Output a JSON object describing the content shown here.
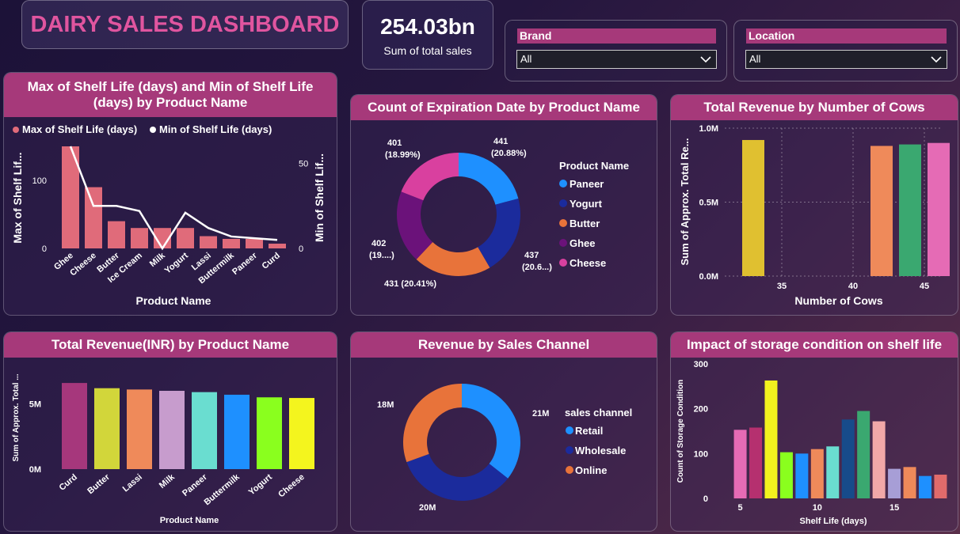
{
  "header": {
    "title": "DAIRY SALES DASHBOARD",
    "kpi_value": "254.03bn",
    "kpi_label": "Sum of total sales"
  },
  "filters": [
    {
      "label": "Brand",
      "value": "All"
    },
    {
      "label": "Location",
      "value": "All"
    }
  ],
  "colors": {
    "title_bar": "#a6397a",
    "title_text": "#e0559f"
  },
  "chart_data": [
    {
      "id": "shelf_life",
      "type": "bar",
      "title": "Max of Shelf Life (days) and Min of Shelf Life (days) by Product Name",
      "title_lines": [
        "Max of Shelf Life (days) and Min of Shelf Life",
        "(days) by Product Name"
      ],
      "xlabel": "Product Name",
      "ylabel": "Max of Shelf Lif...",
      "y2label": "Min of Shelf Lif...",
      "categories": [
        "Ghee",
        "Cheese",
        "Butter",
        "Ice Cream",
        "Milk",
        "Yogurt",
        "Lassi",
        "Buttermilk",
        "Paneer",
        "Curd"
      ],
      "series": [
        {
          "name": "Max of Shelf Life (days)",
          "type": "bar",
          "color": "#e06b7a",
          "values": [
            150,
            90,
            40,
            30,
            30,
            30,
            18,
            14,
            14,
            7
          ]
        },
        {
          "name": "Min of Shelf Life (days)",
          "type": "line",
          "color": "#ffffff",
          "values": [
            60,
            25,
            25,
            22,
            0,
            21,
            12,
            7,
            6,
            5
          ]
        }
      ],
      "ylim": [
        0,
        150
      ],
      "y2lim": [
        0,
        60
      ],
      "yticks": [
        0,
        100
      ],
      "y2ticks": [
        0,
        50
      ]
    },
    {
      "id": "expiration",
      "type": "pie",
      "title": "Count of Expiration Date by Product Name",
      "legend_title": "Product Name",
      "labels": [
        "Paneer",
        "Yogurt",
        "Butter",
        "Ghee",
        "Cheese"
      ],
      "values": [
        441,
        437,
        431,
        402,
        401
      ],
      "colors": [
        "#1e90ff",
        "#1b2b9c",
        "#e8733a",
        "#6b127a",
        "#d9409f"
      ],
      "data_labels": [
        "441 (20.88%)",
        "437 (20.6...)",
        "431 (20.41%)",
        "402 (19....)",
        "401 (18.99%)"
      ]
    },
    {
      "id": "cows",
      "type": "bar",
      "title": "Total Revenue by Number of Cows",
      "xlabel": "Number of Cows",
      "ylabel": "Sum of Approx. Total Re...",
      "x": [
        33,
        42,
        44,
        46
      ],
      "values": [
        0.92,
        0.88,
        0.89,
        0.9
      ],
      "value_unit": "M",
      "colors": [
        "#e0c030",
        "#ef8a5a",
        "#3aa870",
        "#e56bb5"
      ],
      "xticks": [
        35,
        40,
        45
      ],
      "yticks": [
        "0.0M",
        "0.5M",
        "1.0M"
      ],
      "xlim": [
        31,
        47
      ],
      "ylim": [
        0,
        1.0
      ]
    },
    {
      "id": "revenue_product",
      "type": "bar",
      "title": "Total Revenue(INR) by Product Name",
      "xlabel": "Product Name",
      "ylabel": "Sum of Approx. Total ...",
      "categories": [
        "Curd",
        "Butter",
        "Lassi",
        "Milk",
        "Paneer",
        "Buttermilk",
        "Yogurt",
        "Cheese"
      ],
      "values": [
        6.6,
        6.2,
        6.1,
        6.0,
        5.9,
        5.7,
        5.5,
        5.45
      ],
      "value_unit": "M",
      "colors": [
        "#a6377c",
        "#d2d63a",
        "#ef8a5a",
        "#c79ccd",
        "#6addd0",
        "#1e90ff",
        "#8aff1e",
        "#f4f51e"
      ],
      "yticks": [
        "0M",
        "5M"
      ],
      "ylim": [
        0,
        8
      ]
    },
    {
      "id": "sales_channel",
      "type": "pie",
      "title": "Revenue by Sales Channel",
      "legend_title": "sales channel",
      "labels": [
        "Retail",
        "Wholesale",
        "Online"
      ],
      "values": [
        21,
        20,
        18
      ],
      "value_unit": "M",
      "colors": [
        "#1e90ff",
        "#1b2b9c",
        "#e8733a"
      ],
      "data_labels": [
        "21M",
        "20M",
        "18M"
      ]
    },
    {
      "id": "storage",
      "type": "bar",
      "title": "Impact of storage condition on shelf life",
      "xlabel": "Shelf Life (days)",
      "ylabel": "Count of Storage Condition",
      "x": [
        5,
        6,
        7,
        8,
        9,
        10,
        11,
        12,
        13,
        14,
        15,
        16,
        17,
        18
      ],
      "values": [
        153,
        158,
        263,
        103,
        100,
        110,
        116,
        176,
        195,
        172,
        66,
        70,
        50,
        53
      ],
      "colors": [
        "#e56bb5",
        "#b5306f",
        "#f2f21e",
        "#8aff1e",
        "#1e90ff",
        "#ef8a5a",
        "#6addd0",
        "#174b8a",
        "#3aa870",
        "#f2a8a8",
        "#a79ed6",
        "#ef8a5a",
        "#1e90ff",
        "#e06b6b"
      ],
      "xticks": [
        5,
        10,
        15
      ],
      "yticks": [
        0,
        100,
        200,
        300
      ],
      "xlim": [
        4.2,
        18.8
      ],
      "ylim": [
        0,
        300
      ]
    }
  ]
}
